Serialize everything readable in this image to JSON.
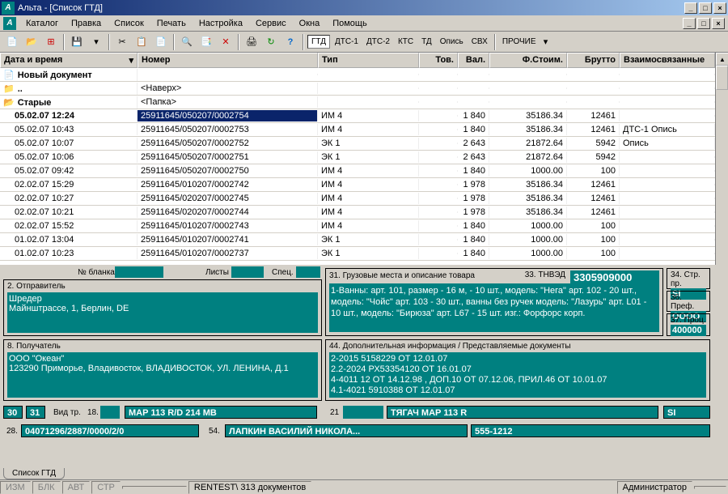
{
  "title": "Альта - [Список ГТД]",
  "menu": [
    "Каталог",
    "Правка",
    "Список",
    "Печать",
    "Настройка",
    "Сервис",
    "Окна",
    "Помощь"
  ],
  "tb_text": [
    "ГТД",
    "ДТС-1",
    "ДТС-2",
    "КТС",
    "ТД",
    "Опись",
    "СВХ",
    "ПРОЧИЕ"
  ],
  "columns": [
    "Дата и время",
    "Номер",
    "Тип",
    "Тов.",
    "Вал.",
    "Ф.Стоим.",
    "Брутто",
    "Взаимосвязанные"
  ],
  "rows": [
    {
      "date": "Новый документ",
      "num": "",
      "type": "",
      "tov": "",
      "val": "",
      "fst": "",
      "br": "",
      "rel": "",
      "kind": "new"
    },
    {
      "date": "..",
      "num": "<Наверх>",
      "type": "",
      "tov": "",
      "val": "",
      "fst": "",
      "br": "",
      "rel": "",
      "kind": "up"
    },
    {
      "date": "Старые",
      "num": "<Папка>",
      "type": "",
      "tov": "",
      "val": "",
      "fst": "",
      "br": "",
      "rel": "",
      "kind": "folder"
    },
    {
      "date": "05.02.07 12:24",
      "num": "25911645/050207/0002754",
      "type": "ИМ 4",
      "tov": "",
      "val": "1 840",
      "fst": "35186.34",
      "br": "12461",
      "rel": "",
      "kind": "sel"
    },
    {
      "date": "05.02.07 10:43",
      "num": "25911645/050207/0002753",
      "type": "ИМ 4",
      "tov": "",
      "val": "1 840",
      "fst": "35186.34",
      "br": "12461",
      "rel": "ДТС-1 Опись"
    },
    {
      "date": "05.02.07 10:07",
      "num": "25911645/050207/0002752",
      "type": "ЭК 1",
      "tov": "",
      "val": "2 643",
      "fst": "21872.64",
      "br": "5942",
      "rel": "Опись"
    },
    {
      "date": "05.02.07 10:06",
      "num": "25911645/050207/0002751",
      "type": "ЭК 1",
      "tov": "",
      "val": "2 643",
      "fst": "21872.64",
      "br": "5942",
      "rel": ""
    },
    {
      "date": "05.02.07 09:42",
      "num": "25911645/050207/0002750",
      "type": "ИМ 4",
      "tov": "",
      "val": "1 840",
      "fst": "1000.00",
      "br": "100",
      "rel": ""
    },
    {
      "date": "02.02.07 15:29",
      "num": "25911645/010207/0002742",
      "type": "ИМ 4",
      "tov": "",
      "val": "1 978",
      "fst": "35186.34",
      "br": "12461",
      "rel": ""
    },
    {
      "date": "02.02.07 10:27",
      "num": "25911645/020207/0002745",
      "type": "ИМ 4",
      "tov": "",
      "val": "1 978",
      "fst": "35186.34",
      "br": "12461",
      "rel": ""
    },
    {
      "date": "02.02.07 10:21",
      "num": "25911645/020207/0002744",
      "type": "ИМ 4",
      "tov": "",
      "val": "1 978",
      "fst": "35186.34",
      "br": "12461",
      "rel": ""
    },
    {
      "date": "02.02.07 15:52",
      "num": "25911645/010207/0002743",
      "type": "ИМ 4",
      "tov": "",
      "val": "1 840",
      "fst": "1000.00",
      "br": "100",
      "rel": ""
    },
    {
      "date": "01.02.07 13:04",
      "num": "25911645/010207/0002741",
      "type": "ЭК 1",
      "tov": "",
      "val": "1 840",
      "fst": "1000.00",
      "br": "100",
      "rel": ""
    },
    {
      "date": "01.02.07 10:23",
      "num": "25911645/010207/0002737",
      "type": "ЭК 1",
      "tov": "",
      "val": "1 840",
      "fst": "1000.00",
      "br": "100",
      "rel": ""
    }
  ],
  "form": {
    "blank_lbl": "№ бланка",
    "list_lbl": "Листы",
    "spec_lbl": "Спец.",
    "f2_lbl": "2. Отправитель",
    "f2_txt": "Шредер\nМайнштрассе, 1, Берлин, DE",
    "f8_lbl": "8. Получатель",
    "f8_txt": "ООО \"Океан\"\n123290 Приморье, Владивосток, ВЛАДИВОСТОК, УЛ. ЛЕНИНА, Д.1",
    "f31_lbl": "31. Грузовые места и описание товара",
    "f33_lbl": "33. ТНВЭД",
    "f33_val": "3305909000",
    "f31_txt": "1-Ванны: арт. 101, размер - 16 м, -  10 шт., модель: \"Нега\" арт. 102 - 20 шт., модель: \"Чойс\" арт. 103 - 30 шт., ванны без ручек модель: \"Лазурь\" арт. L01 - 10 шт., модель: \"Бирюза\" арт. L67 - 15 шт. изг.: Форфорс корп.",
    "f44_lbl": "44. Дополнительная информация / Представляемые документы",
    "f44_txt": "2-2015 5158229 ОТ 12.01.07\n2.2-2024 РХ53354120 ОТ 16.01.07\n4-4011 12 ОТ 14.12.98 , ДОП.10 ОТ 07.12.06, ПРИЛ.46 ОТ 10.01.07\n4.1-4021 5910388 ОТ 12.01.07",
    "f34_lbl": "34. Стр. пр.",
    "f34_val": "SI",
    "f36_lbl": "36. Преф.",
    "f36_val": "ОООО",
    "f37_lbl": "37. Проц.",
    "f37_val": "400000",
    "f30": "30",
    "f31n": "31",
    "vid": "Вид тр.",
    "f18n": "18.",
    "f18v": "МАР 113 R/D 214 МВ",
    "f21n": "21",
    "f21v": "ТЯГАЧ МАР 113 R",
    "f_si": "SI",
    "f28n": "28.",
    "f28v": "04071296/2887/0000/2/0",
    "f54n": "54.",
    "f54v": "ЛАПКИН ВАСИЛИЙ НИКОЛА...",
    "f54p": "555-1212"
  },
  "tab_name": "Список ГТД",
  "status": {
    "flags": [
      "ИЗМ",
      "БЛК",
      "АВТ",
      "СТР"
    ],
    "doc": "RENTEST\\",
    "count": "313 документов",
    "user": "Администратор"
  }
}
